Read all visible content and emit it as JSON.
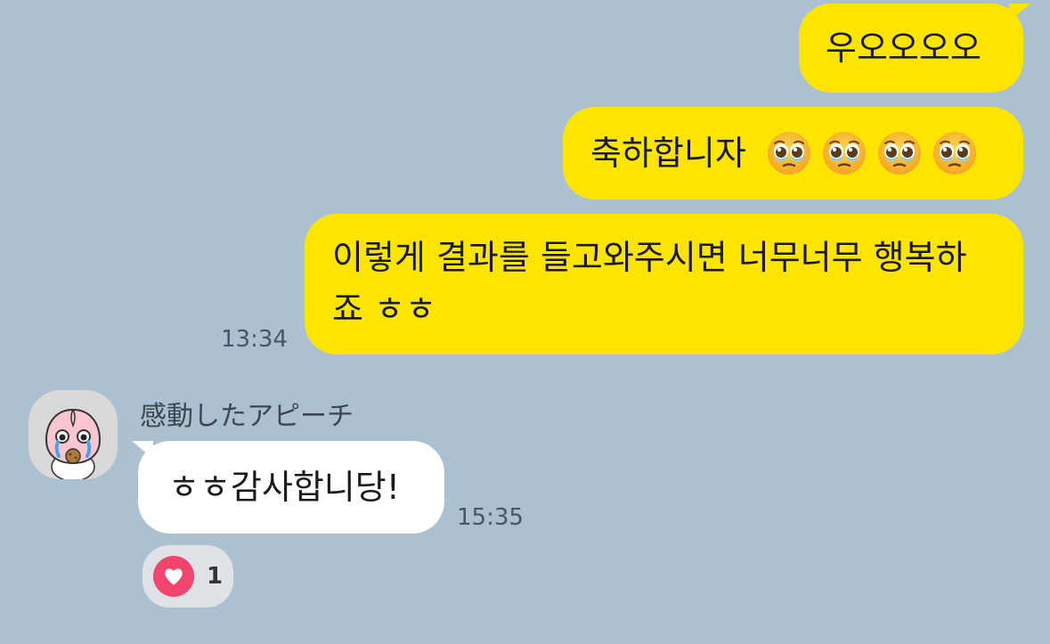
{
  "messages": {
    "m1": {
      "text": "우오오오오"
    },
    "m2": {
      "text": "축하합니자",
      "emoji_name": "pleading-face-emoji"
    },
    "m3": {
      "text": "이렇게 결과를 들고와주시면 너무너무 행복하죠 ㅎㅎ",
      "time": "13:34"
    },
    "m4": {
      "sender": "感動したアピーチ",
      "text": "ㅎㅎ감사합니당!",
      "time": "15:35"
    }
  },
  "reaction": {
    "icon": "heart-icon",
    "count": "1"
  },
  "colors": {
    "background": "#abc1d1",
    "my_bubble": "#fee500",
    "their_bubble": "#ffffff",
    "heart": "#f2456e"
  }
}
